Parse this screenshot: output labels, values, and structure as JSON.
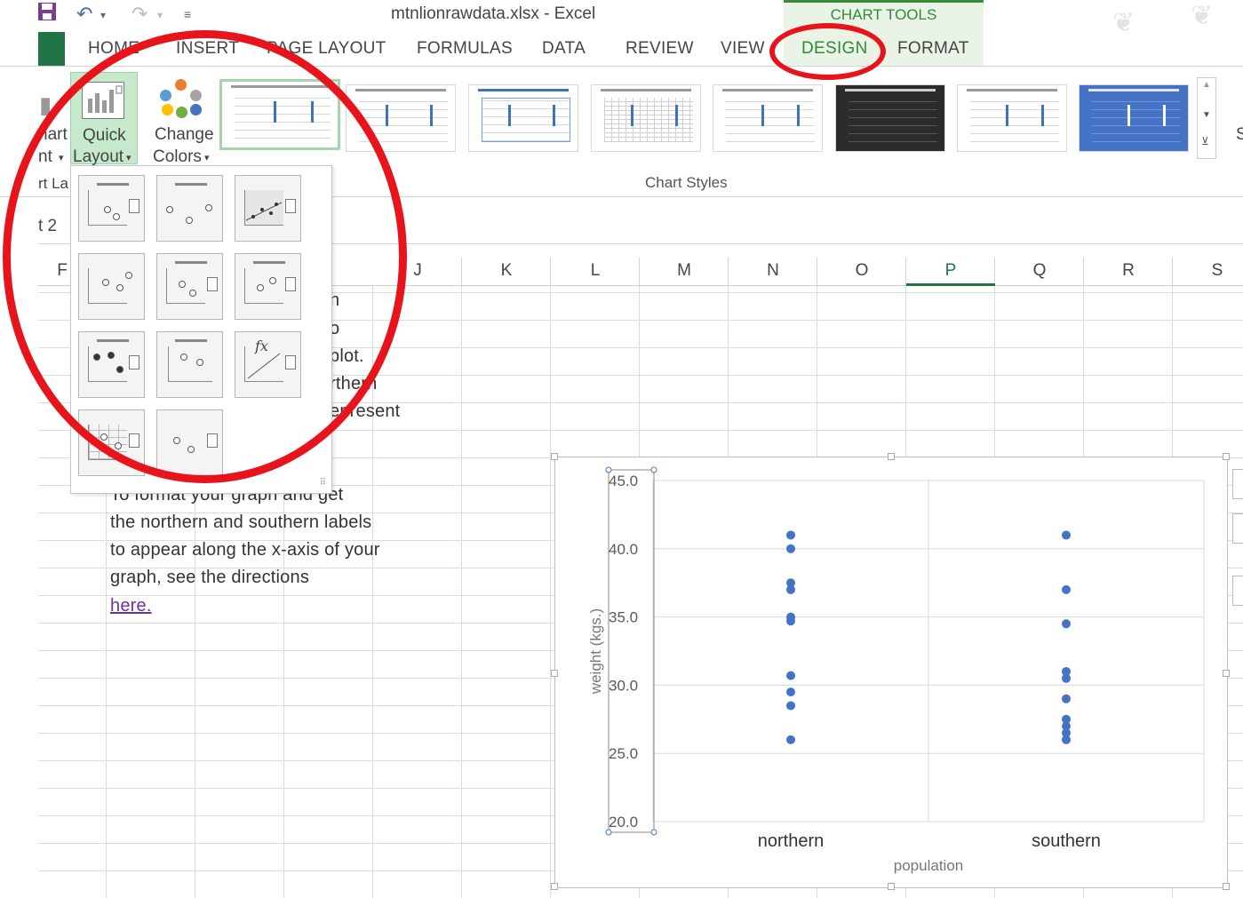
{
  "window": {
    "title": "mtnlionrawdata.xlsx - Excel",
    "context_tab_group": "CHART TOOLS"
  },
  "tabs": [
    {
      "label": "HOME"
    },
    {
      "label": "INSERT"
    },
    {
      "label": "PAGE LAYOUT"
    },
    {
      "label": "FORMULAS"
    },
    {
      "label": "DATA"
    },
    {
      "label": "REVIEW"
    },
    {
      "label": "VIEW"
    },
    {
      "label": "DESIGN",
      "active": true
    },
    {
      "label": "FORMAT"
    }
  ],
  "ribbon": {
    "add_chart_element_partial": [
      "hart",
      "nt"
    ],
    "quick_layout": {
      "line1": "Quick",
      "line2": "Layout"
    },
    "change_colors": {
      "line1": "Change",
      "line2": "Colors"
    },
    "group_label_partial": "rt La",
    "chart_styles_label": "Chart Styles",
    "right_edge_partial": "S"
  },
  "namebox": {
    "value": "t 2"
  },
  "columns": [
    "F",
    "",
    "",
    "",
    "J",
    "K",
    "L",
    "M",
    "N",
    "O",
    "P",
    "Q",
    "R",
    "S"
  ],
  "active_column": "P",
  "sheet_text": {
    "fragments": [
      "n",
      "o",
      "plot.",
      "rthern",
      "epresent"
    ],
    "paragraph": [
      "To format your graph and get",
      "the northern and southern labels",
      "to appear along the x-axis of your",
      "graph, see the directions"
    ],
    "link": "here."
  },
  "colors": {
    "excel_green": "#217346",
    "design_tab": "#2f8a3a",
    "annotation_red": "#e8141b",
    "marker_blue": "#4472c4"
  },
  "chart_data": {
    "type": "scatter",
    "title": "",
    "categories": [
      "northern",
      "southern"
    ],
    "xlabel": "population",
    "ylabel": "weight (kgs.)",
    "ylim": [
      20,
      45
    ],
    "yticks": [
      "20.0",
      "25.0",
      "30.0",
      "35.0",
      "40.0",
      "45.0"
    ],
    "grid": true,
    "series": [
      {
        "category": "northern",
        "values": [
          41.0,
          40.0,
          37.5,
          37.0,
          35.0,
          34.7,
          30.7,
          29.5,
          28.5,
          26.0
        ]
      },
      {
        "category": "southern",
        "values": [
          41.0,
          37.0,
          34.5,
          31.0,
          30.5,
          29.0,
          27.5,
          27.0,
          26.5,
          26.0
        ]
      }
    ]
  }
}
